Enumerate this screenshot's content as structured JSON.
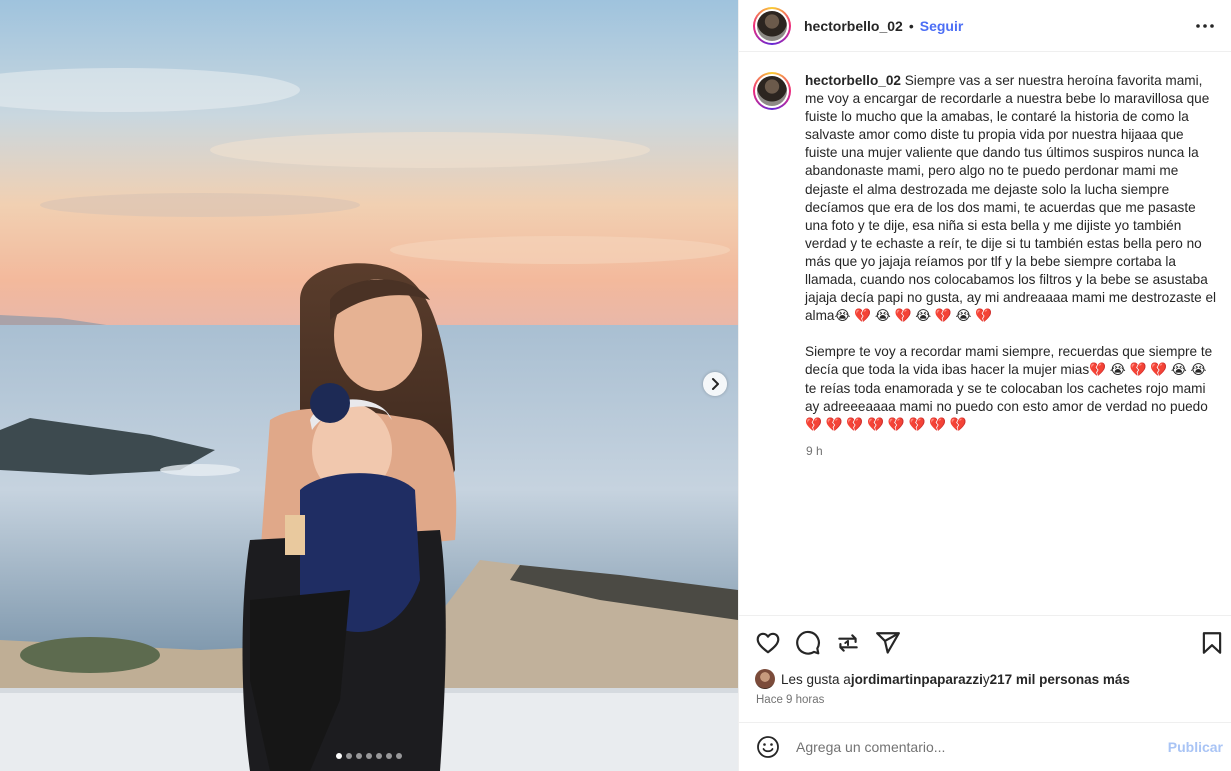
{
  "post": {
    "username": "hectorbello_02",
    "separator": "•",
    "follow_label": "Seguir",
    "caption_username": "hectorbello_02",
    "caption_p1": "Siempre vas a ser nuestra heroína favorita mami, me voy a encargar de recordarle a nuestra bebe lo maravillosa que fuiste lo mucho que la amabas, le contaré la historia de como la salvaste amor como diste tu propia vida por nuestra hijaaa que fuiste una mujer valiente que dando tus últimos suspiros nunca la abandonaste mami, pero algo no te puedo perdonar mami me dejaste el alma destrozada me dejaste solo la lucha siempre decíamos que era de los dos mami, te acuerdas que me pasaste una foto y te dije, esa niña si esta bella y me dijiste yo también verdad y te echaste a reír, te dije si tu también estas bella pero no más que yo jajaja reíamos por tlf y la bebe siempre cortaba la llamada, cuando nos colocabamos los filtros y la bebe se asustaba jajaja decía papi no gusta, ay mi andreaaaa mami me destrozaste el alma😭 💔 😭 💔 😭 💔 😭 💔",
    "caption_p2": "Siempre te voy a recordar mami siempre, recuerdas que siempre te decía que toda la vida ibas hacer la mujer mias💔 😭 💔 💔 😭 😭 te reías toda enamorada y se te colocaban los cachetes rojo mami ay adreeeaaaa mami no puedo con esto amor de verdad no puedo 💔 💔 💔 💔 💔 💔 💔 💔",
    "caption_time": "9 h",
    "likes_prefix": "Les gusta a ",
    "likes_user": "jordimartinpaparazzi",
    "likes_middle": " y ",
    "likes_count": "217 mil personas más",
    "posted_ago": "Hace 9 horas"
  },
  "comment": {
    "placeholder": "Agrega un comentario...",
    "publish_label": "Publicar"
  },
  "carousel": {
    "slide_count": 7,
    "active_index": 0
  },
  "icons": {
    "more": "more-options-icon",
    "next": "chevron-right-icon",
    "like": "heart-icon",
    "comment": "comment-icon",
    "repost": "repost-icon",
    "share": "paper-plane-icon",
    "save": "bookmark-icon",
    "emoji": "emoji-icon"
  },
  "colors": {
    "follow": "#4c6ef5",
    "publish_disabled": "#a9c4f5",
    "muted_text": "#737373"
  }
}
